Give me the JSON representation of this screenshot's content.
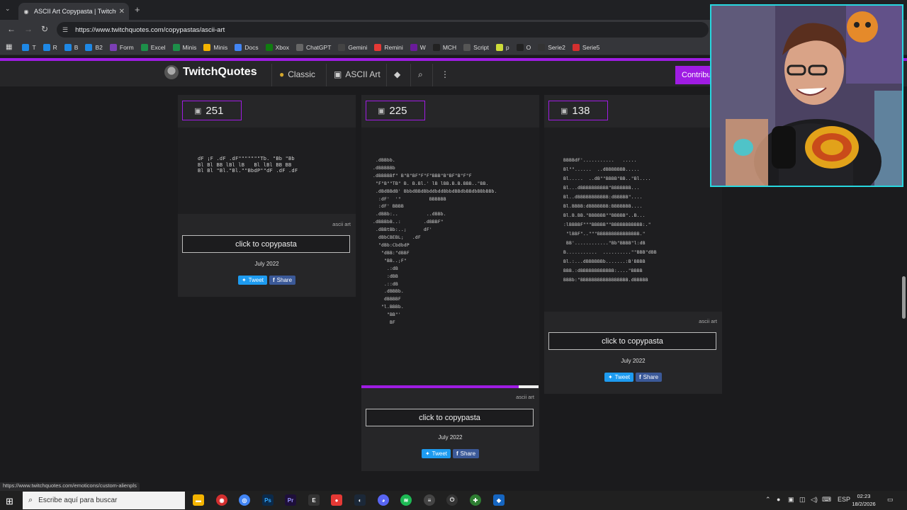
{
  "browser": {
    "tab_title": "ASCII Art Copypasta | TwitchQu",
    "url": "https://www.twitchquotes.com/copypastas/ascii-art",
    "bookmarks": [
      {
        "label": "T",
        "color": "#1e88e5"
      },
      {
        "label": "R",
        "color": "#1e88e5"
      },
      {
        "label": "B",
        "color": "#1e88e5"
      },
      {
        "label": "B2",
        "color": "#1e88e5"
      },
      {
        "label": "Form",
        "color": "#7b3fb5"
      },
      {
        "label": "Excel",
        "color": "#1d8f49"
      },
      {
        "label": "Minis",
        "color": "#1d8f49"
      },
      {
        "label": "Minis",
        "color": "#f4b400"
      },
      {
        "label": "Docs",
        "color": "#4285f4"
      },
      {
        "label": "Xbox",
        "color": "#107c10"
      },
      {
        "label": "ChatGPT",
        "color": "#666666"
      },
      {
        "label": "Gemini",
        "color": "#444444"
      },
      {
        "label": "Remini",
        "color": "#e53935"
      },
      {
        "label": "W",
        "color": "#6a1b9a"
      },
      {
        "label": "MCH",
        "color": "#222222"
      },
      {
        "label": "Script",
        "color": "#555555"
      },
      {
        "label": "p",
        "color": "#cddc39"
      },
      {
        "label": "O",
        "color": "#222222"
      },
      {
        "label": "Serie2",
        "color": "#333333"
      },
      {
        "label": "Serie5",
        "color": "#d32f2f"
      }
    ],
    "status_url": "https://www.twitchquotes.com/emoticons/custom-alienpls"
  },
  "site": {
    "logo": "TwitchQuotes",
    "nav": {
      "classic": "Classic",
      "ascii": "ASCII Art",
      "contribute": "Contribu"
    }
  },
  "cards": [
    {
      "count": "251",
      "tag": "ascii art",
      "button": "click to copypasta",
      "date": "July 2022",
      "tweet": "Tweet",
      "share": "Share",
      "art": "dF ¡F .dF .dF\"\"\"\"\"\"\"Tb. \"Bb \"Bb\nBl Bl BB lBl lB   Bl lBl BB BB\nBl Bl \"Bl.\"Bl.\"\"BbdP\"\"dF .dF .dF"
    },
    {
      "count": "225",
      "tag": "ascii art",
      "button": "click to copypasta",
      "date": "July 2022",
      "tweet": "Tweet",
      "share": "Share",
      "art": " .dBBbb.\n.dBBBBBb\n.dBBBBBf\" B\"B\"BF\"F\"F\"BBB\"B\"BF\"B\"F\"F\n \"F\"B\"\"TB\" B. B.Bl.' lB lBB.B.B.BBB..\"BB.\n .dBdBBdB' BbbdBBdBbddbddBbbdBBdbBBdbBBbBBb.\n  :dF'  '\"          BBBBBB\n  :dF' BBBB\n .dBBb:..          ..dBBb.\n.dBBBbB..:        .dBBBF\"\n .dBBtBb:..;      dF'\n  dBbCBEBL;   .dF\n  \"dBb:CbdbdP\n   \"dBB:\"dBBF\n    \"BB..;F\"\n     .:dB\n     :dBB\n    .::dB\n    .dBBBb.\n    dBBBBF\n   \"l.BBBb.\n     \"BB\"'\n      BF"
    },
    {
      "count": "138",
      "tag": "ascii art",
      "button": "click to copypasta",
      "date": "July 2022",
      "tweet": "Tweet",
      "share": "Share",
      "art": "BBBBdF'...........   .....\nBl\"\"......  ..dBBBBBBB.....\nBl.....  ..dB\"\"BBBB\"BB..\"Bl....\nBl...dBBBBBBBBBB\"BBBBBBB...\nBl..dBBBBBBBBBBB:dBBBBB\"....\nBl.BBBB:dBBBBBBB:BBBBBBB....\nBl.B.BB.\"BBBBBB\"\"BBBBB\"..B...\n:lBBBBF\"\"\"BBBBB\"\"BBBBBBBBBBB:.\"\n \"lBBF\"..\"\"\"BBBBBBBBBBBBBBB.\"\n BB'............\"Bb\"BBBB\"l:dB\nB...........  ..........\"\"BBB\"dBB\nBl.:...dBBBBBBb.......:B'BBBB\nBBB.:dBBBBBBBBBBBB:....\"BBBB\nBBBb:\"BBBBBBBBBBBBBBBBB.dBBBBB"
    }
  ],
  "taskbar": {
    "search_placeholder": "Escribe aquí para buscar",
    "lang": "ESP",
    "time": "02:23",
    "date": "18/2/2026"
  }
}
